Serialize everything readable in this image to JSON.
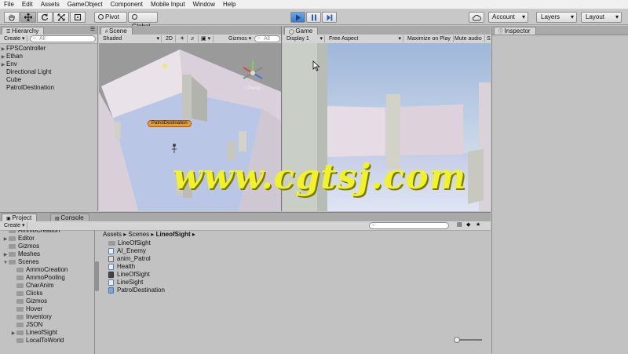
{
  "menu": [
    "File",
    "Edit",
    "Assets",
    "GameObject",
    "Component",
    "Mobile Input",
    "Window",
    "Help"
  ],
  "toolbar": {
    "pivot": "Pivot",
    "global": "Global",
    "account": "Account",
    "layers": "Layers",
    "layout": "Layout"
  },
  "hierarchy": {
    "tab": "Hierarchy",
    "create": "Create",
    "search_placeholder": "All",
    "items": [
      "FPSController",
      "Ethan",
      "Env",
      "Directional Light",
      "Cube",
      "PatrolDestination"
    ]
  },
  "scene": {
    "tab": "Scene",
    "shading": "Shaded",
    "mode2d": "2D",
    "gizmos": "Gizmos",
    "search_placeholder": "All",
    "label": "PatrolDestination",
    "persp": "< Persp"
  },
  "game": {
    "tab": "Game",
    "display": "Display 1",
    "aspect": "Free Aspect",
    "maximize": "Maximize on Play",
    "mute": "Mute audio",
    "stats": "S"
  },
  "inspector": {
    "tab": "Inspector"
  },
  "project": {
    "tab": "Project",
    "console_tab": "Console",
    "create": "Create",
    "tree": [
      {
        "label": "AmmoCreation",
        "indent": 1,
        "arrow": ""
      },
      {
        "label": "Editor",
        "indent": 1,
        "arrow": "▶"
      },
      {
        "label": "Gizmos",
        "indent": 1,
        "arrow": ""
      },
      {
        "label": "Meshes",
        "indent": 1,
        "arrow": "▶"
      },
      {
        "label": "Scenes",
        "indent": 1,
        "arrow": "▼"
      },
      {
        "label": "AmmoCreation",
        "indent": 2,
        "arrow": ""
      },
      {
        "label": "AmmoPooling",
        "indent": 2,
        "arrow": ""
      },
      {
        "label": "CharAnim",
        "indent": 2,
        "arrow": ""
      },
      {
        "label": "Clicks",
        "indent": 2,
        "arrow": ""
      },
      {
        "label": "Gizmos",
        "indent": 2,
        "arrow": ""
      },
      {
        "label": "Hover",
        "indent": 2,
        "arrow": ""
      },
      {
        "label": "Inventory",
        "indent": 2,
        "arrow": ""
      },
      {
        "label": "JSON",
        "indent": 2,
        "arrow": ""
      },
      {
        "label": "LineofSight",
        "indent": 2,
        "arrow": "▶"
      },
      {
        "label": "LocalToWorld",
        "indent": 2,
        "arrow": ""
      }
    ],
    "breadcrumb": [
      "Assets",
      "Scenes",
      "LineofSight"
    ],
    "files": [
      {
        "label": "LineOfSight",
        "icon": "folder"
      },
      {
        "label": "AI_Enemy",
        "icon": "script"
      },
      {
        "label": "anim_Patrol",
        "icon": "anim"
      },
      {
        "label": "Health",
        "icon": "script"
      },
      {
        "label": "LineOfSight",
        "icon": "scene"
      },
      {
        "label": "LineSight",
        "icon": "script"
      },
      {
        "label": "PatrolDestination",
        "icon": "prefab"
      }
    ]
  },
  "watermark": "www.cgtsj.com",
  "colors": {
    "accent": "#3b79c8",
    "watermark": "#f2f22a"
  }
}
